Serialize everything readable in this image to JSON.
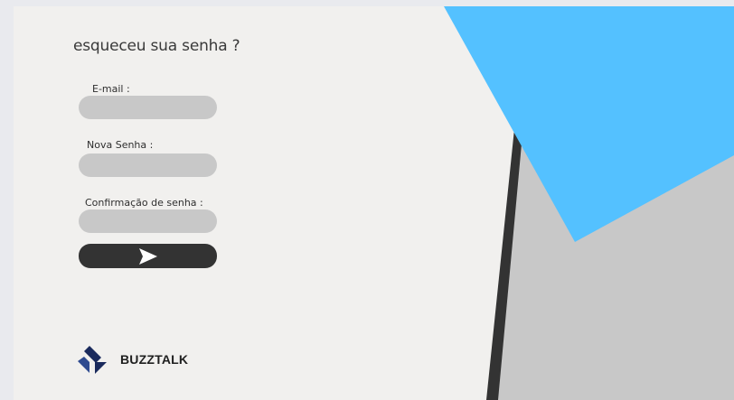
{
  "form": {
    "title": "esqueceu sua senha ?",
    "fields": [
      {
        "label": "E-mail  :",
        "value": "",
        "placeholder": ""
      },
      {
        "label": "Nova Senha  :",
        "value": "",
        "placeholder": ""
      },
      {
        "label": "Confirmação de senha  :",
        "value": "",
        "placeholder": ""
      }
    ],
    "submit_icon": "send-arrow-icon"
  },
  "brand": {
    "name": "BUZZTALK",
    "logo_icon": "buzztalk-logo-icon"
  },
  "colors": {
    "accent_blue": "#54c1ff",
    "stripe_dark": "#333333",
    "panel_gray": "#c8c8c8",
    "input_gray": "#c8c8c8",
    "background": "#f1f0ee",
    "logo_navy": "#1a2a5c"
  }
}
